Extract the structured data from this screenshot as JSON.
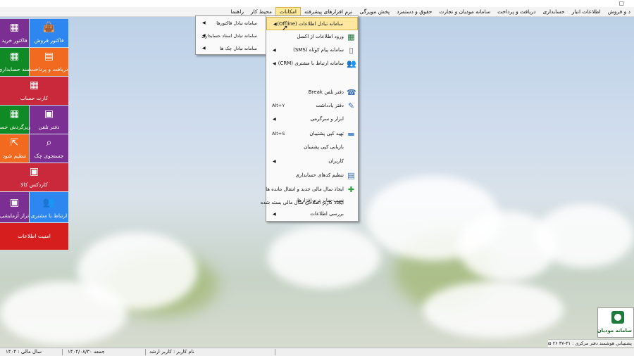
{
  "window": {
    "restore_glyph": "▢"
  },
  "menubar": {
    "items": [
      {
        "label": "د و فروش"
      },
      {
        "label": "اطلاعات انبار"
      },
      {
        "label": "حسابداری"
      },
      {
        "label": "دریافت و پرداخت"
      },
      {
        "label": "سامانه مودیان و تجارت"
      },
      {
        "label": "حقوق و دستمزد"
      },
      {
        "label": "پخش مویرگی"
      },
      {
        "label": "نرم افزارهای پیشرفته"
      },
      {
        "label": "امکانات",
        "active": true
      },
      {
        "label": "محیط کار"
      },
      {
        "label": "راهنما"
      }
    ]
  },
  "tiles": {
    "sales_invoice": {
      "label": "فاکتور فروش",
      "icon": "shopping-bag-icon",
      "glyph": "👜"
    },
    "purchase_invoice": {
      "label": "فاکتور خرید",
      "icon": "grid-plus-icon",
      "glyph": "▦"
    },
    "receive_pay": {
      "label": "دریافت و پرداخت",
      "icon": "calculator-icon",
      "glyph": "▤"
    },
    "accounting_doc": {
      "label": "سند حسابداری",
      "icon": "grid-plus-icon",
      "glyph": "▦"
    },
    "account_card": {
      "label": "کارت حساب",
      "icon": "table-icon",
      "glyph": "▦"
    },
    "phonebook": {
      "label": "دفتر تلفن",
      "icon": "squares-icon",
      "glyph": "▣"
    },
    "account_turnover": {
      "label": "ریزگردش حسا",
      "icon": "grid-plus-icon",
      "glyph": "▦"
    },
    "cheque_search": {
      "label": "جستجوی چک",
      "icon": "search-screen-icon",
      "glyph": "⌕"
    },
    "settle": {
      "label": "تنظیم شود",
      "icon": "external-icon",
      "glyph": "⇱"
    },
    "kardex": {
      "label": "کاردکس کالا",
      "icon": "squares-icon",
      "glyph": "▣"
    },
    "crm": {
      "label": "ارتباط با مشتری",
      "icon": "users-icon",
      "glyph": "👥"
    },
    "trial_balance": {
      "label": "تراز آزمایشی",
      "icon": "squares-icon",
      "glyph": "▣"
    },
    "info_security": {
      "label": "امنیت اطلاعات"
    }
  },
  "dropdown": {
    "items": [
      {
        "label": "سامانه تبادل اطلاعات (Offline)",
        "arrow": "◀",
        "highlighted": true,
        "icon": "",
        "glyph": ""
      },
      {
        "label": "ورود اطلاعات  از  اکسل",
        "arrow": "",
        "icon": "excel-icon",
        "glyph": "▦"
      },
      {
        "label": "سامانه پیام کوتاه (SMS)",
        "arrow": "◀",
        "icon": "phone-icon",
        "glyph": "▯"
      },
      {
        "label": "سامانه ارتباط با مشتری (CRM)",
        "arrow": "◀",
        "icon": "people-icon",
        "glyph": "👥"
      },
      {
        "label": "دفتر تلفن  Break",
        "arrow": "",
        "icon": "phone-book-icon",
        "glyph": "☎"
      },
      {
        "label": "دفتر یادداشت",
        "shortcut": "Alt+Y",
        "icon": "note-icon",
        "glyph": "✎"
      },
      {
        "label": "ابزار و سرگرمی",
        "arrow": "◀",
        "icon": "",
        "glyph": ""
      },
      {
        "label": "تهیه کپی پشتیبان",
        "shortcut": "Alt+S",
        "icon": "backup-icon",
        "glyph": "▬"
      },
      {
        "label": "بازیابی کپی پشتیبان",
        "arrow": "",
        "icon": "",
        "glyph": ""
      },
      {
        "label": "کاربران",
        "arrow": "◀",
        "icon": "",
        "glyph": ""
      },
      {
        "label": "تنظیم کدهای حسابداری",
        "arrow": "",
        "icon": "table-icon",
        "glyph": "▤"
      },
      {
        "label": "ایجاد سال مالی جدید و انتقال مانده ها",
        "arrow": "",
        "icon": "plus-icon",
        "glyph": "✚"
      },
      {
        "label": "ایجاد کاربر اصلاحی سال مالی بسته شده",
        "arrow": "",
        "icon": "",
        "glyph": ""
      },
      {
        "label": "نصب سایر نرم افزارها",
        "arrow": "",
        "icon": "",
        "glyph": ""
      },
      {
        "label": "بررسی اطلاعات",
        "arrow": "◀",
        "icon": "",
        "glyph": ""
      }
    ]
  },
  "submenu": {
    "items": [
      {
        "label": "سامانه تبادل فاکتورها",
        "arrow": "◀"
      },
      {
        "label": "سامانه تبادل اسناد حسابداری",
        "arrow": "◀"
      },
      {
        "label": "سامانه تبادل چک ها",
        "arrow": "◀"
      }
    ]
  },
  "logo": {
    "text": "سامانه مودیان"
  },
  "support": {
    "text": "پشتیبانی هوشمند دفتر مرکزی : ۳۱-۳۷ ۲۶ ۵۵ ۴۴ -"
  },
  "statusbar": {
    "fiscal_year": "سال مالی : ۱۴۰۴",
    "date": "جمعه   ۱۴۰۴/۰۸/۳۰",
    "user": "نام کاربر : کاربر ارشد"
  },
  "colors": {
    "menu_highlight": "#ffe7a0",
    "tile_purple": "#7b2f93",
    "tile_blue": "#2e86f0",
    "tile_green": "#0f8a24",
    "tile_orange": "#f26a1f",
    "tile_red": "#c9293a"
  }
}
